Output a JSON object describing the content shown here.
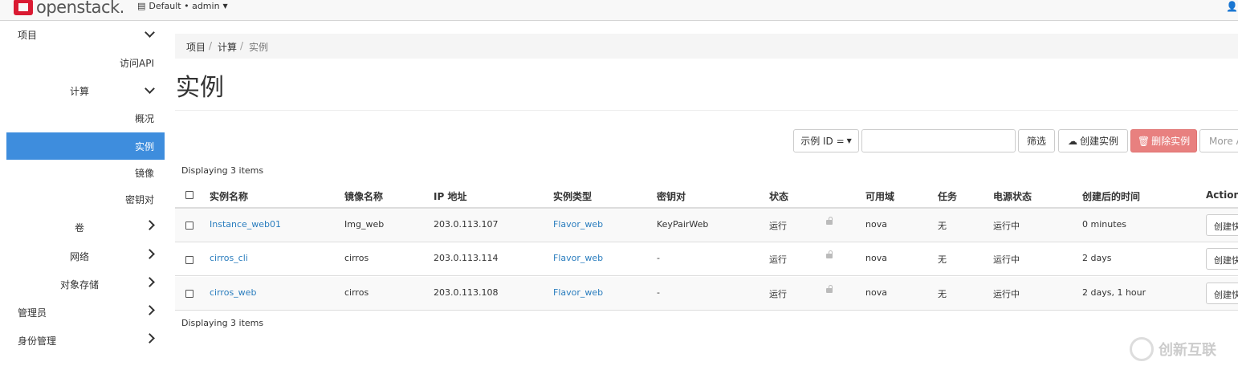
{
  "header": {
    "logo_text": "openstack.",
    "project_selector": "Default • admin"
  },
  "sidebar": {
    "project": "项目",
    "api_access": "访问API",
    "compute": "计算",
    "overview": "概况",
    "instances": "实例",
    "images": "镜像",
    "keypairs": "密钥对",
    "volumes": "卷",
    "network": "网络",
    "object_store": "对象存储",
    "admin": "管理员",
    "identity": "身份管理"
  },
  "breadcrumb": {
    "item1": "项目",
    "item2": "计算",
    "item3": "实例",
    "sep": "/"
  },
  "page_title": "实例",
  "toolbar": {
    "filter_select": "示例 ID =",
    "filter_input_value": "",
    "filter_button": "筛选",
    "create_button": "创建实例",
    "delete_button": "删除实例",
    "more_button": "More A"
  },
  "table": {
    "displaying": "Displaying 3 items",
    "headers": {
      "name": "实例名称",
      "image": "镜像名称",
      "ip": "IP 地址",
      "flavor": "实例类型",
      "keypair": "密钥对",
      "status": "状态",
      "az": "可用域",
      "task": "任务",
      "power": "电源状态",
      "age": "创建后的时间",
      "actions": "Actions"
    },
    "rows": [
      {
        "name": "Instance_web01",
        "image": "Img_web",
        "ip": "203.0.113.107",
        "flavor": "Flavor_web",
        "keypair": "KeyPairWeb",
        "status": "运行",
        "az": "nova",
        "task": "无",
        "power": "运行中",
        "age": "0 minutes",
        "action": "创建快"
      },
      {
        "name": "cirros_cli",
        "image": "cirros",
        "ip": "203.0.113.114",
        "flavor": "Flavor_web",
        "keypair": "-",
        "status": "运行",
        "az": "nova",
        "task": "无",
        "power": "运行中",
        "age": "2 days",
        "action": "创建快"
      },
      {
        "name": "cirros_web",
        "image": "cirros",
        "ip": "203.0.113.108",
        "flavor": "Flavor_web",
        "keypair": "-",
        "status": "运行",
        "az": "nova",
        "task": "无",
        "power": "运行中",
        "age": "2 days, 1 hour",
        "action": "创建快"
      }
    ]
  },
  "watermark": "创新互联",
  "colors": {
    "accent": "#3e8ddd",
    "link": "#2a7dbe",
    "danger": "#e8807f",
    "brand": "#da1a32"
  }
}
